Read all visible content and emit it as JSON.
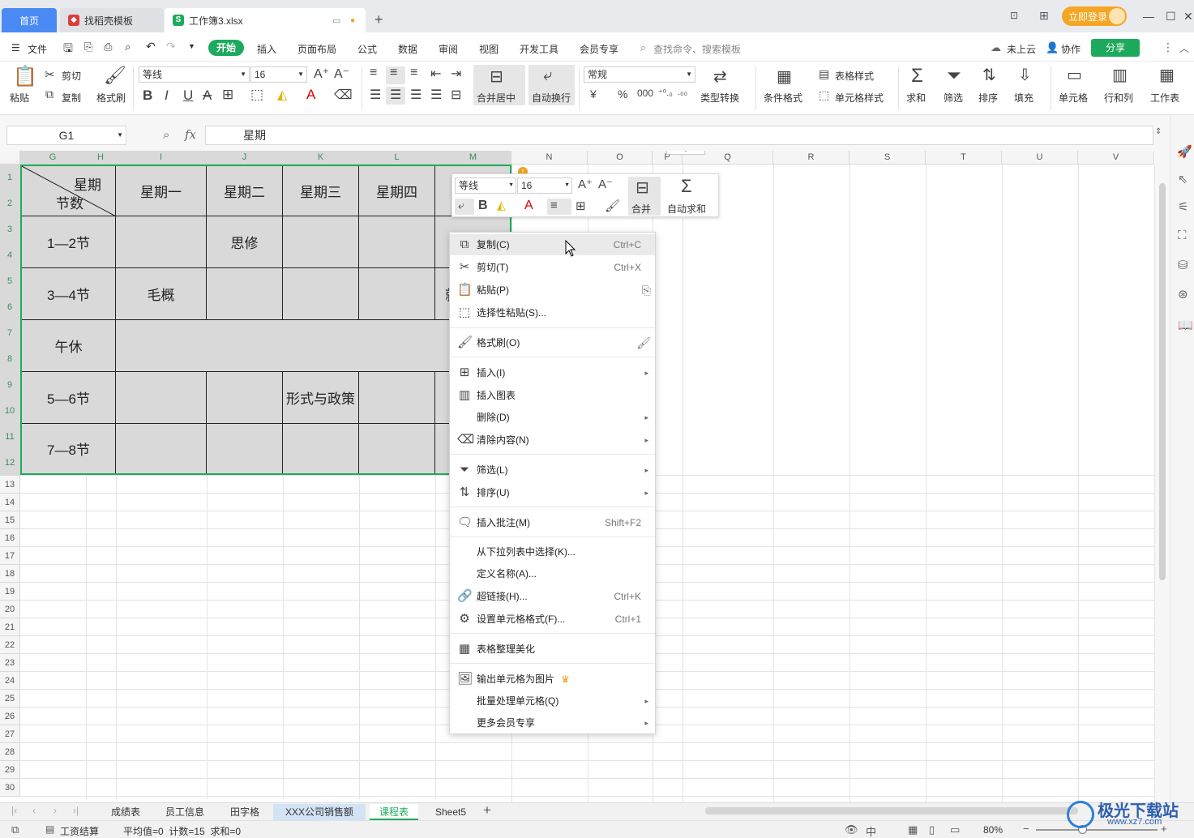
{
  "tabs": {
    "home": "首页",
    "template": "找稻壳模板",
    "workbook": "工作簿3.xlsx"
  },
  "title_right": {
    "login": "立即登录"
  },
  "menus": [
    "文件",
    "开始",
    "插入",
    "页面布局",
    "公式",
    "数据",
    "审阅",
    "视图",
    "开发工具",
    "会员专享"
  ],
  "search_placeholder": "查找命令、搜索模板",
  "top_right": {
    "cloud": "未上云",
    "collab": "协作",
    "share": "分享"
  },
  "ribbon": {
    "paste": "粘贴",
    "cut": "剪切",
    "copy": "复制",
    "format_painter": "格式刷",
    "font": "等线",
    "font_size": "16",
    "merge_center": "合并居中",
    "wrap": "自动换行",
    "number_format": "常规",
    "type_convert": "类型转换",
    "cond_format": "条件格式",
    "table_style": "表格样式",
    "cell_style": "单元格样式",
    "sum": "求和",
    "filter": "筛选",
    "sort": "排序",
    "fill": "填充",
    "cell": "单元格",
    "rowcol": "行和列",
    "worksheet": "工作表"
  },
  "formula_bar": {
    "name_box": "G1",
    "fx": "fx",
    "content": "星期"
  },
  "columns": [
    "G",
    "H",
    "I",
    "J",
    "K",
    "L",
    "M",
    "N",
    "O",
    "P",
    "Q",
    "R",
    "S",
    "T",
    "U",
    "V"
  ],
  "schedule": {
    "corner_top": "星期",
    "corner_bottom": "节数",
    "days": [
      "星期一",
      "星期二",
      "星期三",
      "星期四"
    ],
    "periods": [
      "1—2节",
      "3—4节",
      "午休",
      "5—6节",
      "7—8节"
    ],
    "course_siyi": "思修",
    "course_maogai": "毛概",
    "course_xingshi": "形式与政策",
    "course_partial": "就"
  },
  "mini_toolbar": {
    "font": "等线",
    "size": "16",
    "merge": "合并",
    "autosum": "自动求和"
  },
  "context_menu": [
    {
      "label": "复制(C)",
      "shortcut": "Ctrl+C"
    },
    {
      "label": "剪切(T)",
      "shortcut": "Ctrl+X"
    },
    {
      "label": "粘贴(P)",
      "shortcut": ""
    },
    {
      "label": "选择性粘贴(S)...",
      "shortcut": ""
    },
    {
      "label": "格式刷(O)",
      "shortcut": ""
    },
    {
      "label": "插入(I)",
      "shortcut": ""
    },
    {
      "label": "插入图表",
      "shortcut": ""
    },
    {
      "label": "删除(D)",
      "shortcut": ""
    },
    {
      "label": "清除内容(N)",
      "shortcut": ""
    },
    {
      "label": "筛选(L)",
      "shortcut": ""
    },
    {
      "label": "排序(U)",
      "shortcut": ""
    },
    {
      "label": "插入批注(M)",
      "shortcut": "Shift+F2"
    },
    {
      "label": "从下拉列表中选择(K)...",
      "shortcut": ""
    },
    {
      "label": "定义名称(A)...",
      "shortcut": ""
    },
    {
      "label": "超链接(H)...",
      "shortcut": "Ctrl+K"
    },
    {
      "label": "设置单元格格式(F)...",
      "shortcut": "Ctrl+1"
    },
    {
      "label": "表格整理美化",
      "shortcut": ""
    },
    {
      "label": "输出单元格为图片",
      "shortcut": ""
    },
    {
      "label": "批量处理单元格(Q)",
      "shortcut": ""
    },
    {
      "label": "更多会员专享",
      "shortcut": ""
    }
  ],
  "sheets": [
    "成绩表",
    "员工信息",
    "田字格",
    "XXX公司销售额",
    "课程表",
    "Sheet5"
  ],
  "active_sheet": "课程表",
  "status": {
    "macro": "工资结算",
    "stats": "平均值=0  计数=15  求和=0",
    "zoom": "80%"
  },
  "watermark": {
    "brand": "极光下载站",
    "url": "www.xz7.com"
  },
  "colors": {
    "accent": "#1eaa5d",
    "home_tab": "#4a8af4",
    "login": "#f5a623"
  }
}
